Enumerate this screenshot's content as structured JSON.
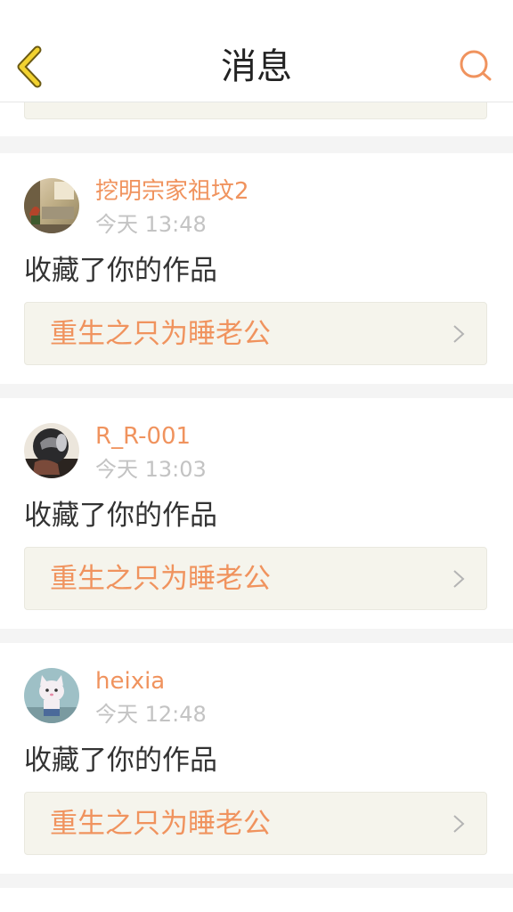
{
  "header": {
    "title": "消息",
    "back_icon": "chevron-left-icon",
    "search_icon": "search-icon",
    "accent_color": "#f0935e"
  },
  "notifications": [
    {
      "username": "挖明宗家祖坟2",
      "time": "今天 13:48",
      "action": "收藏了你的作品",
      "work_title": "重生之只为睡老公",
      "avatar": "avatar-room-photo"
    },
    {
      "username": "R_R-001",
      "time": "今天 13:03",
      "action": "收藏了你的作品",
      "work_title": "重生之只为睡老公",
      "avatar": "avatar-helmet-photo"
    },
    {
      "username": "heixia",
      "time": "今天 12:48",
      "action": "收藏了你的作品",
      "work_title": "重生之只为睡老公",
      "avatar": "avatar-cat-doll-photo"
    }
  ]
}
